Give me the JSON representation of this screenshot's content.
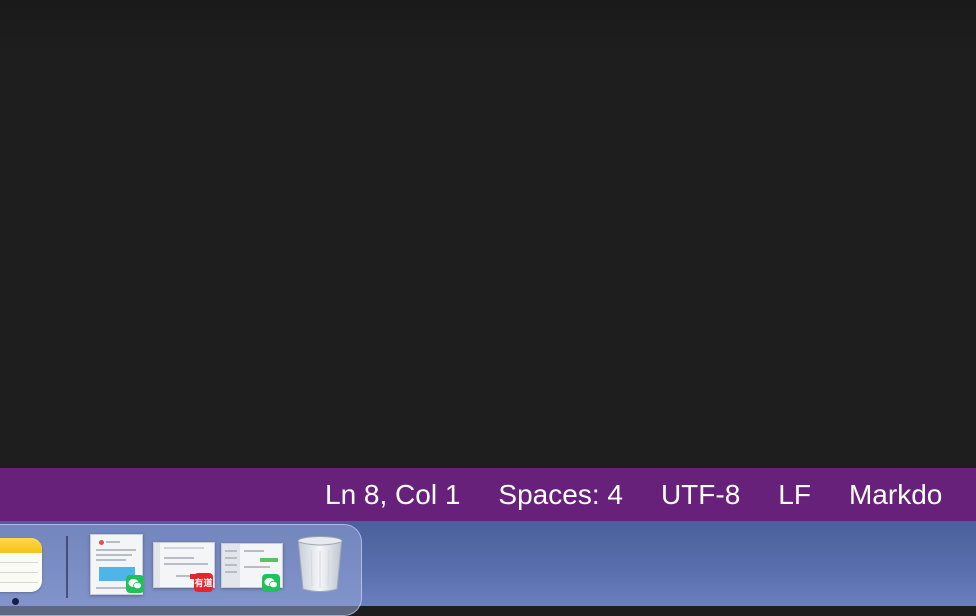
{
  "statusbar": {
    "cursor_position": "Ln 8, Col 1",
    "indentation": "Spaces: 4",
    "encoding": "UTF-8",
    "line_ending": "LF",
    "language_mode": "Markdo",
    "background_color": "#68217a"
  },
  "dock": {
    "items": [
      {
        "icon": "notes-icon",
        "running": true
      },
      {
        "icon": "wechat-window-thumbnail-icon",
        "badge": "wechat-icon"
      },
      {
        "icon": "youdao-window-thumbnail-icon",
        "badge": "youdao-icon",
        "badge_text": "有道"
      },
      {
        "icon": "wechat-window-thumbnail-icon",
        "badge": "wechat-icon"
      },
      {
        "icon": "trash-icon"
      }
    ]
  },
  "colors": {
    "editor_background": "#1e1e1e",
    "desktop_background": "#5a70ae"
  }
}
